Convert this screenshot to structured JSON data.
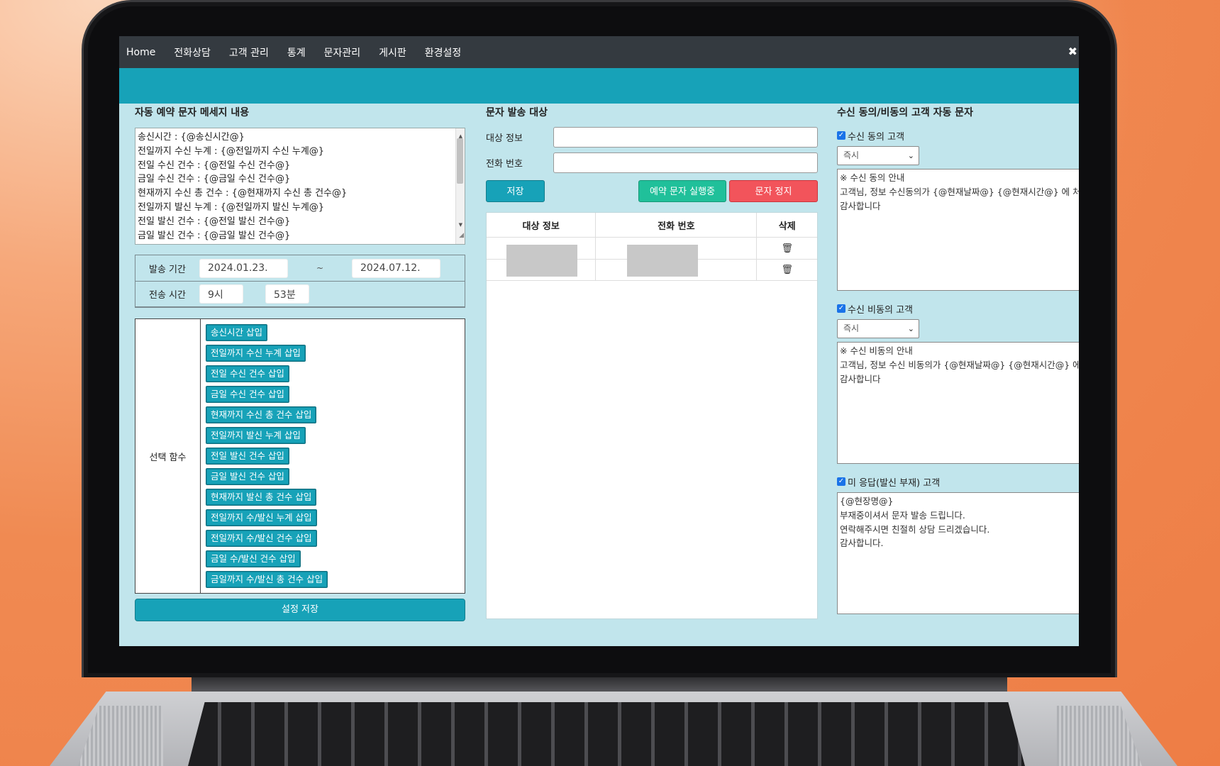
{
  "nav": {
    "items": [
      "Home",
      "전화상담",
      "고객 관리",
      "통계",
      "문자관리",
      "게시판",
      "환경설정"
    ],
    "close_label": "✖"
  },
  "left": {
    "title": "자동 예약 문자 메세지 내용",
    "message_lines": [
      "송신시간 : {@송신시간@}",
      "전일까지 수신 누계 : {@전일까지 수신 누계@}",
      "전일 수신 건수 : {@전일 수신 건수@}",
      "금일 수신 건수 : {@금일 수신 건수@}",
      "현재까지 수신 총 건수 : {@현재까지 수신 총 건수@}",
      "전일까지 발신 누계 : {@전일까지 발신 누계@}",
      "전일 발신 건수 : {@전일 발신 건수@}",
      "금일 발신 건수 : {@금일 발신 건수@}"
    ],
    "period_label": "발송 기간",
    "period_start": "2024.01.23.",
    "period_sep": "~",
    "period_end": "2024.07.12.",
    "time_label": "전송 시간",
    "time_hour": "9시",
    "time_minute": "53분",
    "func_label": "선택 함수",
    "func_buttons": [
      "송신시간 삽입",
      "전일까지 수신 누계 삽입",
      "전일 수신 건수 삽입",
      "금일 수신 건수 삽입",
      "현재까지 수신 총 건수 삽입",
      "전일까지 발신 누계 삽입",
      "전일 발신 건수 삽입",
      "금일 발신 건수 삽입",
      "현재까지 발신 총 건수 삽입",
      "전일까지 수/발신 누계 삽입",
      "전일까지 수/발신 건수 삽입",
      "금일 수/발신 건수 삽입",
      "금일까지 수/발신 총 건수 삽입"
    ],
    "save_settings": "설정 저장"
  },
  "middle": {
    "title": "문자 발송 대상",
    "target_label": "대상 정보",
    "target_value": "",
    "phone_label": "전화 번호",
    "phone_value": "",
    "save_btn": "저장",
    "running_btn": "예약 문자 실행중",
    "stop_btn": "문자 정지",
    "table_headers": [
      "대상 정보",
      "전화 번호",
      "삭제"
    ],
    "row_count": 2,
    "trash_icon": "trash-icon"
  },
  "right": {
    "title": "수신 동의/비동의 고객 자동 문자",
    "consent_label": "수신 동의 고객",
    "consent_checked": true,
    "consent_select": "즉시",
    "consent_text": [
      "※ 수신 동의 안내",
      "고객님, 정보 수신동의가 {@현재날짜@} {@현재시간@} 에 처리",
      "감사합니다"
    ],
    "nonconsent_label": "수신 비동의 고객",
    "nonconsent_checked": true,
    "nonconsent_select": "즉시",
    "nonconsent_text": [
      "※ 수신 비동의 안내",
      "고객님, 정보 수신 비동의가 {@현재날짜@} {@현재시간@} 에 처리",
      "감사합니다"
    ],
    "noanswer_label": "미 응답(발신 부재) 고객",
    "noanswer_checked": true,
    "noanswer_text": [
      "{@현장명@}",
      "부재중이셔서 문자 발송 드립니다.",
      "연락해주시면 친절히 상담 드리겠습니다.",
      "감사합니다."
    ]
  },
  "colors": {
    "navbar": "#343a40",
    "accent": "#17a2b8",
    "panel_bg": "#c1e5ec",
    "running": "#20c09a",
    "stop": "#f2545b"
  }
}
